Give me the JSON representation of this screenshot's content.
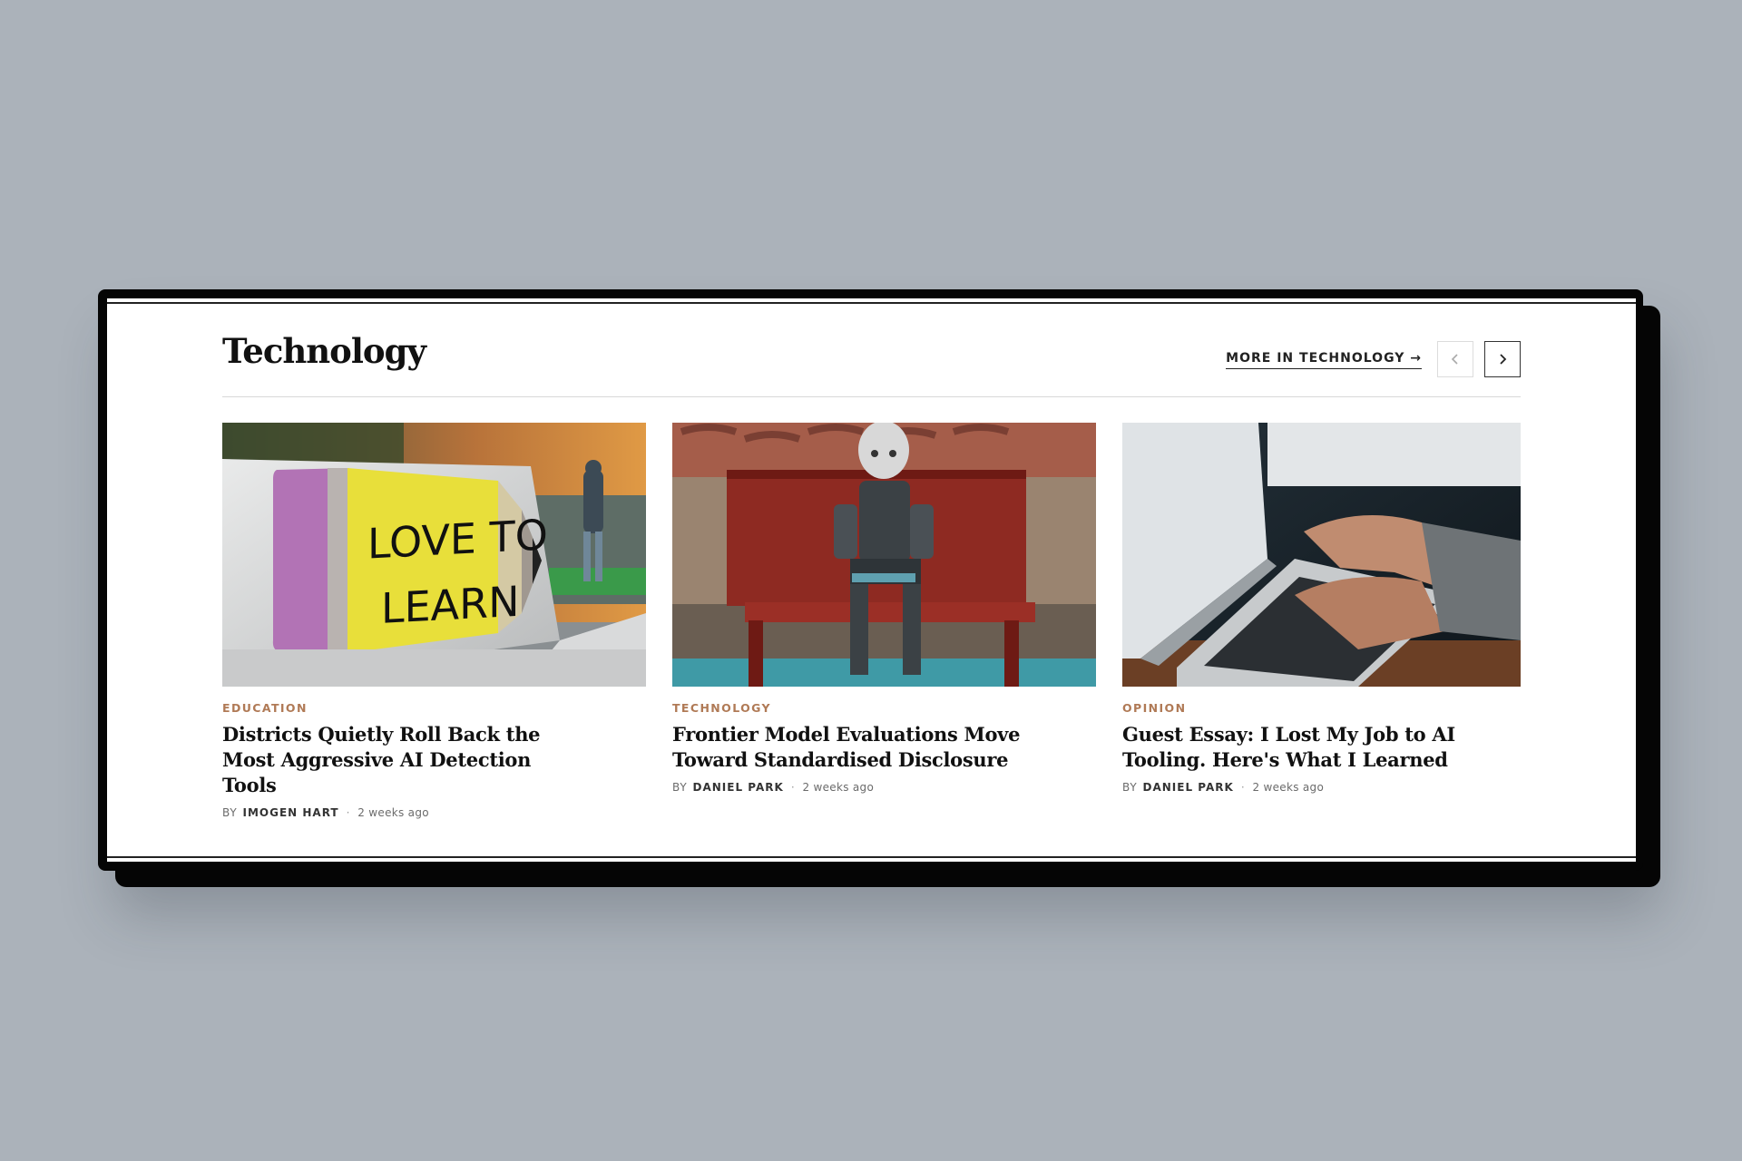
{
  "section": {
    "title": "Technology",
    "more_link": "MORE IN TECHNOLOGY →",
    "prev_icon": "chevron-left-icon",
    "next_icon": "chevron-right-icon"
  },
  "articles": [
    {
      "category": "EDUCATION",
      "headline": "Districts Quietly Roll Back the Most Aggressive AI Detection Tools",
      "by": "BY",
      "author": "IMOGEN HART",
      "time": "2 weeks ago",
      "image_text_line1": "LOVE TO",
      "image_text_line2": "LEARN"
    },
    {
      "category": "TECHNOLOGY",
      "headline": "Frontier Model Evaluations Move Toward Standardised Disclosure",
      "by": "BY",
      "author": "DANIEL PARK",
      "time": "2 weeks ago"
    },
    {
      "category": "OPINION",
      "headline": "Guest Essay: I Lost My Job to AI Tooling. Here's What I Learned",
      "by": "BY",
      "author": "DANIEL PARK",
      "time": "2 weeks ago"
    }
  ],
  "colors": {
    "background": "#abb2ba",
    "category": "#b07a56",
    "text": "#111111"
  }
}
